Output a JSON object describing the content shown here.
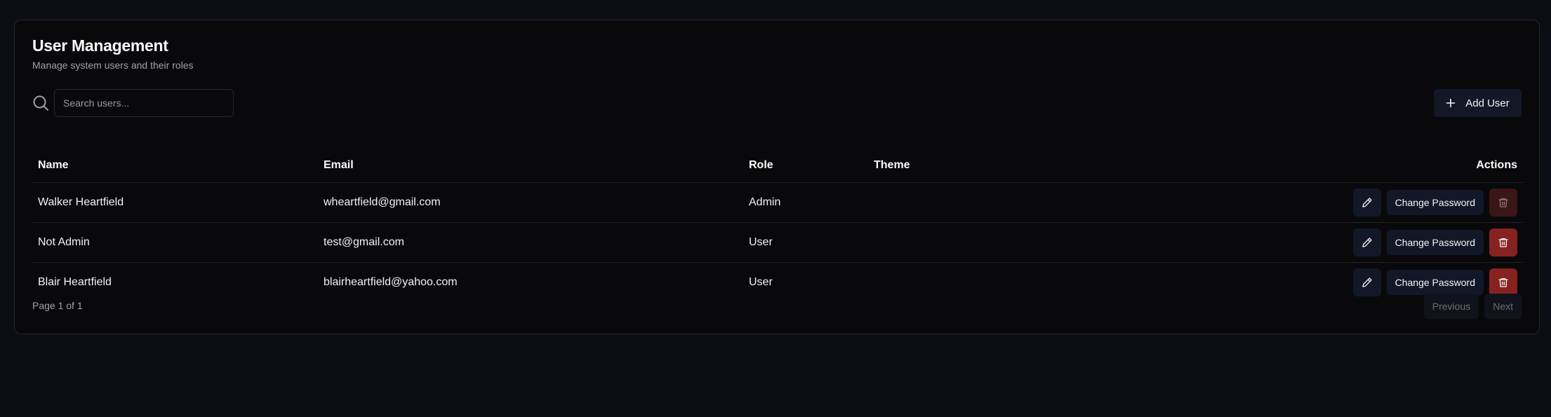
{
  "header": {
    "title": "User Management",
    "subtitle": "Manage system users and their roles"
  },
  "search": {
    "placeholder": "Search users...",
    "value": ""
  },
  "toolbar": {
    "add_user_label": "Add User"
  },
  "table": {
    "columns": [
      "Name",
      "Email",
      "Role",
      "Theme",
      "Actions"
    ],
    "rows": [
      {
        "name": "Walker Heartfield",
        "email": "wheartfield@gmail.com",
        "role": "Admin",
        "theme": "",
        "change_password_label": "Change Password",
        "delete_disabled": true
      },
      {
        "name": "Not Admin",
        "email": "test@gmail.com",
        "role": "User",
        "theme": "",
        "change_password_label": "Change Password",
        "delete_disabled": false
      },
      {
        "name": "Blair Heartfield",
        "email": "blairheartfield@yahoo.com",
        "role": "User",
        "theme": "",
        "change_password_label": "Change Password",
        "delete_disabled": false
      }
    ]
  },
  "pagination": {
    "page_info": "Page 1 of 1",
    "previous_label": "Previous",
    "next_label": "Next"
  },
  "colors": {
    "background": "#0b0e14",
    "card": "#09090b",
    "secondary_button": "#121827",
    "destructive": "#862220",
    "destructive_disabled": "#3a1616"
  },
  "icons": [
    "search-icon",
    "plus-icon",
    "pencil-icon",
    "trash-icon"
  ]
}
